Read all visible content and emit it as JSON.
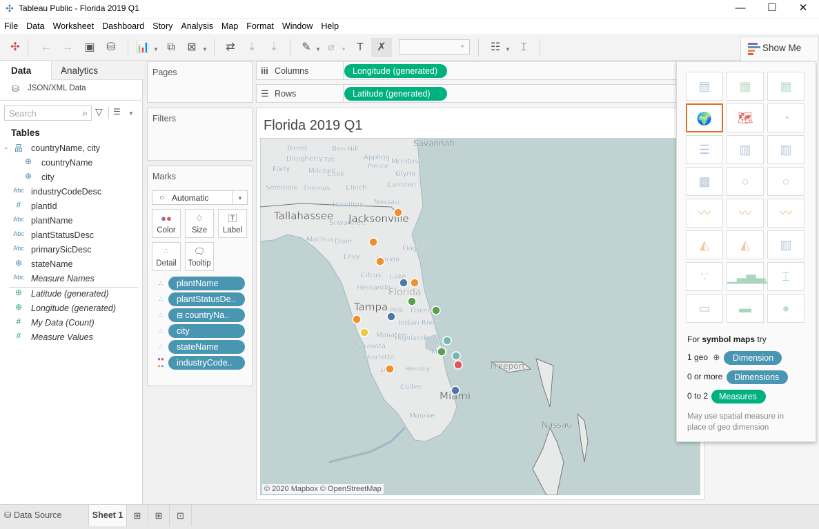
{
  "window": {
    "title": "Tableau Public - Florida 2019 Q1",
    "controls": [
      "minimize",
      "maximize",
      "close"
    ]
  },
  "menu": [
    "File",
    "Data",
    "Worksheet",
    "Dashboard",
    "Story",
    "Analysis",
    "Map",
    "Format",
    "Window",
    "Help"
  ],
  "toolbar": {
    "icons": [
      "tableau-logo",
      "undo",
      "redo",
      "save",
      "new-data-source",
      "new-worksheet",
      "duplicate-sheet",
      "clear-sheet",
      "swap-rows-columns",
      "sort-ascending",
      "sort-descending",
      "highlight",
      "attach",
      "show-labels",
      "fix-axes",
      "fit-dropdown",
      "show-cards",
      "presentation-mode"
    ],
    "fit_value": "",
    "show_me_label": "Show Me"
  },
  "left_panel": {
    "tab_data": "Data",
    "tab_analytics": "Analytics",
    "data_source": "JSON/XML Data",
    "search_placeholder": "Search",
    "tables_header": "Tables",
    "fields": [
      {
        "type": "hierarchy",
        "name": "countryName, city"
      },
      {
        "type": "geo",
        "name": "countryName",
        "child": true
      },
      {
        "type": "geo",
        "name": "city",
        "child": true
      },
      {
        "type": "Abc",
        "name": "industryCodeDesc"
      },
      {
        "type": "#",
        "name": "plantId"
      },
      {
        "type": "Abc",
        "name": "plantName"
      },
      {
        "type": "Abc",
        "name": "plantStatusDesc"
      },
      {
        "type": "Abc",
        "name": "primarySicDesc"
      },
      {
        "type": "geo",
        "name": "stateName"
      },
      {
        "type": "Abc",
        "name": "Measure Names",
        "italic": true
      }
    ],
    "measures": [
      {
        "type": "geo",
        "name": "Latitude (generated)"
      },
      {
        "type": "geo",
        "name": "Longitude (generated)"
      },
      {
        "type": "#",
        "name": "My Data (Count)"
      },
      {
        "type": "#",
        "name": "Measure Values"
      }
    ]
  },
  "cards": {
    "pages": "Pages",
    "filters": "Filters",
    "marks": "Marks",
    "mark_type": "Automatic",
    "buttons": [
      "Color",
      "Size",
      "Label",
      "Detail",
      "Tooltip"
    ],
    "mark_pills": [
      {
        "encoding": "detail",
        "label": "plantName"
      },
      {
        "encoding": "detail",
        "label": "plantStatusDe.."
      },
      {
        "encoding": "detail",
        "label": "countryNa..",
        "collapse": true
      },
      {
        "encoding": "detail",
        "label": "city"
      },
      {
        "encoding": "detail",
        "label": "stateName"
      },
      {
        "encoding": "color",
        "label": "industryCode.."
      }
    ]
  },
  "shelves": {
    "columns_label": "Columns",
    "columns_pill": "Longitude (generated)",
    "rows_label": "Rows",
    "rows_pill": "Latitude (generated)"
  },
  "viz": {
    "title": "Florida 2019 Q1",
    "attribution": "© 2020 Mapbox © OpenStreetMap",
    "map_labels": [
      {
        "text": "Savannah",
        "cls": "city"
      },
      {
        "text": "Terrell"
      },
      {
        "text": "Ben Hill"
      },
      {
        "text": "Appling"
      },
      {
        "text": "Dougherty"
      },
      {
        "text": "Tift"
      },
      {
        "text": "Pierce"
      },
      {
        "text": "McIntosh"
      },
      {
        "text": "Early"
      },
      {
        "text": "Mitchell"
      },
      {
        "text": "Cook"
      },
      {
        "text": "Glynn"
      },
      {
        "text": "Seminole"
      },
      {
        "text": "Thomas"
      },
      {
        "text": "Clinch"
      },
      {
        "text": "Camden"
      },
      {
        "text": "Hamilton"
      },
      {
        "text": "Nassau"
      },
      {
        "text": "Tallahassee",
        "cls": "big"
      },
      {
        "text": "Suwannee"
      },
      {
        "text": "Jacksonville",
        "cls": "big"
      },
      {
        "text": "Alachua"
      },
      {
        "text": "Dixie"
      },
      {
        "text": "Flagler"
      },
      {
        "text": "Levy"
      },
      {
        "text": "Marion"
      },
      {
        "text": "Citrus"
      },
      {
        "text": "Lake"
      },
      {
        "text": "Hernando"
      },
      {
        "text": "Florida",
        "cls": "state"
      },
      {
        "text": "Tampa",
        "cls": "big"
      },
      {
        "text": "Polk"
      },
      {
        "text": "Osceola"
      },
      {
        "text": "Indian River"
      },
      {
        "text": "Manatee"
      },
      {
        "text": "Highlands"
      },
      {
        "text": "Sarasota"
      },
      {
        "text": "Martin"
      },
      {
        "text": "Charlotte"
      },
      {
        "text": "Lee"
      },
      {
        "text": "Hendry"
      },
      {
        "text": "Collier"
      },
      {
        "text": "Miami",
        "cls": "big"
      },
      {
        "text": "Monroe"
      },
      {
        "text": "Freeport",
        "cls": "city"
      },
      {
        "text": "Nassau",
        "cls": "city"
      }
    ],
    "points": [
      {
        "place": "Jacksonville",
        "color": "#f28e2b"
      },
      {
        "place": "Alachua",
        "color": "#f28e2b"
      },
      {
        "place": "Marion",
        "color": "#f28e2b"
      },
      {
        "place": "Lake",
        "color": "#4e79a7"
      },
      {
        "place": "Lake East",
        "color": "#f28e2b"
      },
      {
        "place": "Orange",
        "color": "#59a14f"
      },
      {
        "place": "Brevard",
        "color": "#59a14f"
      },
      {
        "place": "Polk",
        "color": "#4e79a7"
      },
      {
        "place": "Pinellas",
        "color": "#f28e2b"
      },
      {
        "place": "Manatee",
        "color": "#edc948"
      },
      {
        "place": "St. Lucie",
        "color": "#76b7b2"
      },
      {
        "place": "Martin",
        "color": "#59a14f"
      },
      {
        "place": "Palm Beach N",
        "color": "#76b7b2"
      },
      {
        "place": "Palm Beach",
        "color": "#e15759"
      },
      {
        "place": "Lee",
        "color": "#f28e2b"
      },
      {
        "place": "Miami",
        "color": "#4e79a7"
      }
    ]
  },
  "show_me": {
    "chart_types": [
      "text-table",
      "heat-map",
      "highlight-table",
      "symbol-map",
      "filled-map",
      "pie-chart",
      "horizontal-bars",
      "stacked-bars",
      "side-by-side-bars",
      "treemap",
      "circle-views",
      "side-by-side-circles",
      "lines-continuous",
      "lines-discrete",
      "dual-lines",
      "area-continuous",
      "area-discrete",
      "dual-combination",
      "scatter-plot",
      "histogram",
      "box-and-whisker",
      "gantt-chart",
      "bullet-graph",
      "packed-bubbles"
    ],
    "selected": "symbol-map",
    "hint_prefix": "For ",
    "hint_bold": "symbol maps",
    "hint_suffix": " try",
    "req": [
      {
        "label": "1 geo",
        "pill": "Dimension",
        "color": "blue",
        "geo_icon": true
      },
      {
        "label": "0 or more",
        "pill": "Dimensions",
        "color": "blue"
      },
      {
        "label": "0 to 2",
        "pill": "Measures",
        "color": "green"
      }
    ],
    "note": "May use spatial measure in place of geo dimension"
  },
  "bottom_tabs": {
    "data_source": "Data Source",
    "sheet": "Sheet 1"
  },
  "colors": {
    "dimension_pill": "#4996b2",
    "measure_pill": "#00b180",
    "selected_thumb": "#e06f2c",
    "map_water": "#c0d3d2"
  }
}
